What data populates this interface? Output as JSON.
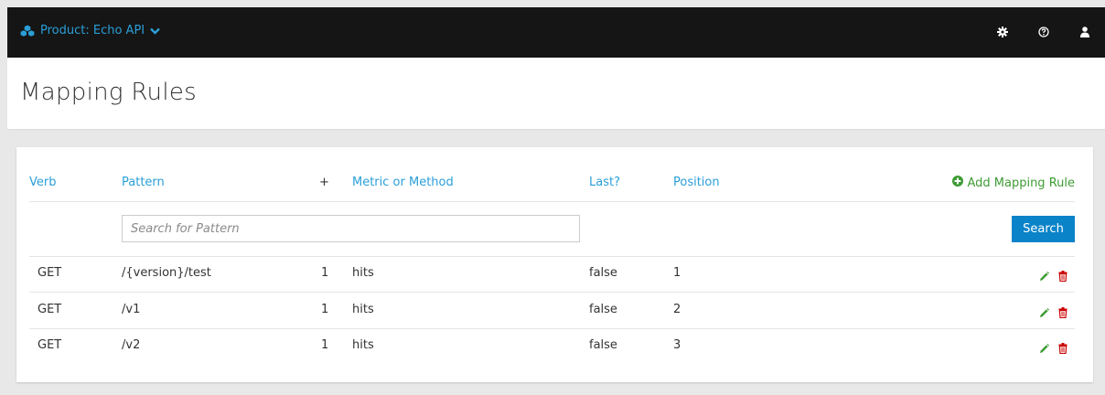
{
  "topbar": {
    "product_label": "Product: Echo API",
    "icons": [
      "cubes-icon",
      "chevron-down-icon",
      "gear-icon",
      "help-icon",
      "user-icon"
    ]
  },
  "page": {
    "title": "Mapping Rules"
  },
  "table": {
    "headers": {
      "verb": "Verb",
      "pattern": "Pattern",
      "plus": "+",
      "metric": "Metric or Method",
      "last": "Last?",
      "position": "Position"
    },
    "add_rule_label": "Add Mapping Rule",
    "search": {
      "placeholder": "Search for Pattern",
      "value": "",
      "button_label": "Search"
    },
    "rows": [
      {
        "verb": "GET",
        "pattern": "/{version}/test",
        "delta": "1",
        "metric": "hits",
        "last": "false",
        "position": "1"
      },
      {
        "verb": "GET",
        "pattern": "/v1",
        "delta": "1",
        "metric": "hits",
        "last": "false",
        "position": "2"
      },
      {
        "verb": "GET",
        "pattern": "/v2",
        "delta": "1",
        "metric": "hits",
        "last": "false",
        "position": "3"
      }
    ]
  },
  "colors": {
    "link_blue": "#2a9fd8",
    "add_green": "#3f9c35",
    "search_button": "#0a83c9",
    "edit_green": "#3f9c35",
    "delete_red": "#cc0000",
    "topbar": "#151515"
  }
}
